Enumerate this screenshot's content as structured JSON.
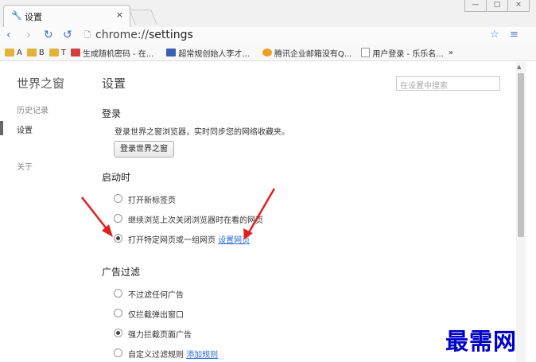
{
  "tab": {
    "title": "设置",
    "close": "×"
  },
  "window": {
    "min": "—",
    "max": "□",
    "close": "×"
  },
  "toolbar": {
    "url_prefix": "chrome://",
    "url_host": "settings"
  },
  "bookmarks": [
    {
      "label": "A",
      "icon": "folder-icon"
    },
    {
      "label": "B",
      "icon": "folder-icon"
    },
    {
      "label": "T",
      "icon": "folder-icon"
    },
    {
      "label": "生成随机密码 - 在...",
      "icon": "site-icon"
    },
    {
      "label": "超常规创始人李才...",
      "icon": "site-icon"
    },
    {
      "label": "腾讯企业邮箱没有Q...",
      "icon": "site-icon"
    },
    {
      "label": "用户登录 - 乐乐名...",
      "icon": "page-icon"
    }
  ],
  "bookmarks_more": "»",
  "sidebar": {
    "title": "世界之窗",
    "items": [
      "历史记录",
      "设置",
      "关于"
    ]
  },
  "main": {
    "title": "设置",
    "search_placeholder": "在设置中搜索",
    "login": {
      "heading": "登录",
      "desc": "登录世界之窗浏览器，实时同步您的网络收藏夹。",
      "button": "登录世界之窗"
    },
    "startup": {
      "heading": "启动时",
      "options": [
        "打开新标签页",
        "继续浏览上次关闭浏览器时在看的网页",
        "打开特定网页或一组网页"
      ],
      "link": "设置网页",
      "selected": 2
    },
    "adblock": {
      "heading": "广告过滤",
      "options": [
        "不过滤任何广告",
        "仅拦截弹出窗口",
        "强力拦截页面广告",
        "自定义过滤规则"
      ],
      "link": "添加规则",
      "selected": 2
    }
  },
  "watermark": "最需网"
}
